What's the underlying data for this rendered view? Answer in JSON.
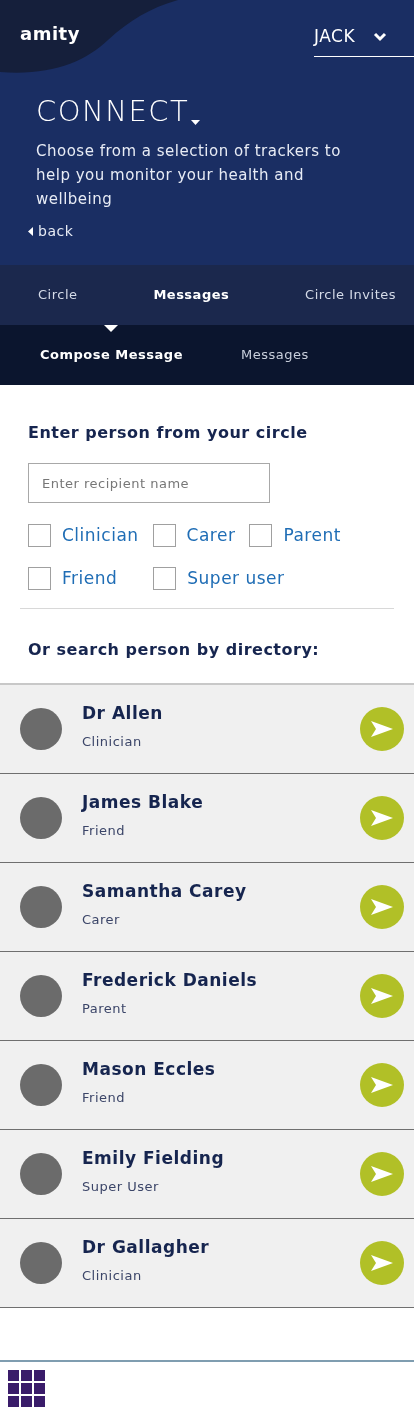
{
  "header": {
    "logo": "amity",
    "user_menu": {
      "label": "JACK"
    },
    "title": "CONNECT",
    "description": "Choose from a selection of trackers to help you monitor your health and wellbeing",
    "back_link": "back"
  },
  "tabs": [
    {
      "label": "Circle",
      "selected": false
    },
    {
      "label": "Messages",
      "selected": true
    },
    {
      "label": "Circle Invites",
      "selected": false
    }
  ],
  "subtabs": [
    {
      "label": "Compose Message",
      "selected": true
    },
    {
      "label": "Messages",
      "selected": false
    }
  ],
  "compose": {
    "heading": "Enter person from your circle",
    "recipient_field": {
      "placeholder": "Enter recipient name"
    },
    "filters": [
      {
        "label": "Clinician",
        "checked": false
      },
      {
        "label": "Carer",
        "checked": false
      },
      {
        "label": "Parent",
        "checked": false
      },
      {
        "label": "Friend",
        "checked": false
      },
      {
        "label": "Super user",
        "checked": false
      }
    ],
    "directory_heading": "Or search person by directory:"
  },
  "directory": [
    {
      "name": "Dr Allen",
      "role": "Clinician"
    },
    {
      "name": "James Blake",
      "role": "Friend"
    },
    {
      "name": "Samantha Carey",
      "role": "Carer"
    },
    {
      "name": "Frederick Daniels",
      "role": "Parent"
    },
    {
      "name": "Mason Eccles",
      "role": "Friend"
    },
    {
      "name": "Emily Fielding",
      "role": "Super User"
    },
    {
      "name": "Dr Gallagher",
      "role": "Clinician"
    }
  ]
}
